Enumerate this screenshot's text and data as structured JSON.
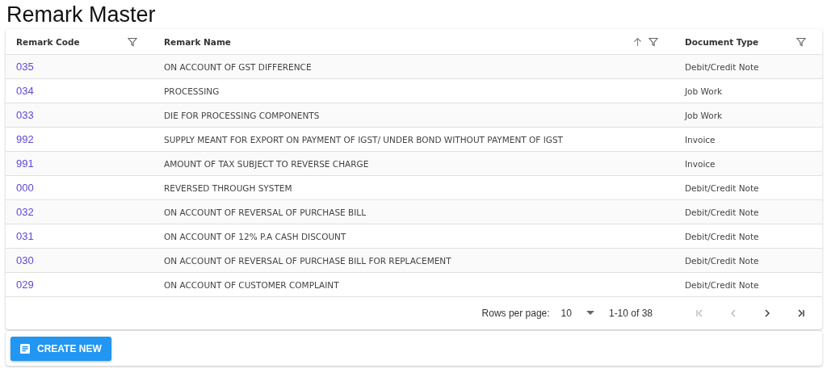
{
  "title": "Remark Master",
  "table": {
    "columns": [
      {
        "label": "Remark Code",
        "sorted": false
      },
      {
        "label": "Remark Name",
        "sorted": true
      },
      {
        "label": "Document Type",
        "sorted": false
      }
    ],
    "rows": [
      [
        "035",
        "ON ACCOUNT OF GST DIFFERENCE",
        "Debit/Credit Note"
      ],
      [
        "034",
        "PROCESSING",
        "Job Work"
      ],
      [
        "033",
        "DIE FOR PROCESSING COMPONENTS",
        "Job Work"
      ],
      [
        "992",
        "SUPPLY MEANT FOR EXPORT ON PAYMENT OF IGST/ UNDER BOND WITHOUT PAYMENT OF IGST",
        "Invoice"
      ],
      [
        "991",
        "AMOUNT OF TAX SUBJECT TO REVERSE CHARGE",
        "Invoice"
      ],
      [
        "000",
        "REVERSED THROUGH SYSTEM",
        "Debit/Credit Note"
      ],
      [
        "032",
        "ON ACCOUNT OF REVERSAL OF PURCHASE BILL",
        "Debit/Credit Note"
      ],
      [
        "031",
        "ON ACCOUNT OF 12% P.A CASH DISCOUNT",
        "Debit/Credit Note"
      ],
      [
        "030",
        "ON ACCOUNT OF REVERSAL OF PURCHASE BILL FOR REPLACEMENT",
        "Debit/Credit Note"
      ],
      [
        "029",
        "ON ACCOUNT OF CUSTOMER COMPLAINT",
        "Debit/Credit Note"
      ]
    ]
  },
  "pagination": {
    "rows_per_page_label": "Rows per page:",
    "rows_per_page": "10",
    "range": "1-10 of 38",
    "buttons": [
      {
        "kind": "first",
        "disabled": true
      },
      {
        "kind": "prev",
        "disabled": true
      },
      {
        "kind": "next",
        "disabled": false
      },
      {
        "kind": "last",
        "disabled": false
      }
    ]
  },
  "create_button": "CREATE NEW"
}
